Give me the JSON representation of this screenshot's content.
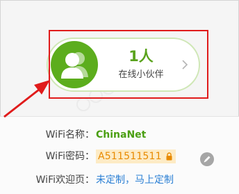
{
  "online": {
    "count_text": "1人",
    "subtitle": "在线小伙伴",
    "icon": "user-group-icon"
  },
  "wifi": {
    "name_label": "WiFi名称：",
    "name_value": "ChinaNet",
    "password_label": "WiFi密码：",
    "password_value": "A511511511",
    "welcome_label": "WiFi欢迎页：",
    "welcome_value": "未定制，马上定制"
  },
  "colors": {
    "accent_green": "#5cad1d",
    "annotation_red": "#e01b1b",
    "password_bg": "#fdebc5",
    "password_text": "#e88a00",
    "link_blue": "#2a7fd4"
  },
  "icons": {
    "avatar": "user-group-icon",
    "chevron": "chevron-right-icon",
    "lock": "lock-icon",
    "edit": "pencil-icon",
    "annotation": "red-arrow-annotation"
  }
}
